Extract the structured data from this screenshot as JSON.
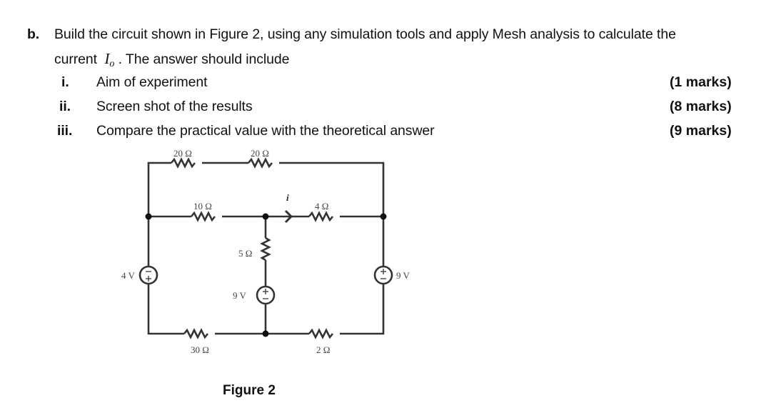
{
  "question": {
    "label": "b.",
    "line1": "Build the circuit shown in Figure 2, using any simulation tools and apply Mesh analysis to calculate the",
    "line2_prefix": "current",
    "variable_main": "I",
    "variable_sub": "o",
    "line2_suffix": ". The answer should include"
  },
  "items": [
    {
      "numeral": "i.",
      "text": "Aim of experiment",
      "marks": "(1 marks)"
    },
    {
      "numeral": "ii.",
      "text": "Screen shot of the results",
      "marks": "(8 marks)"
    },
    {
      "numeral": "iii.",
      "text": "Compare the practical value with the theoretical answer",
      "marks": "(9 marks)"
    }
  ],
  "figure": {
    "caption": "Figure 2",
    "components": {
      "r_top_left": "20 Ω",
      "r_top_right": "20 Ω",
      "r_mid_left": "10 Ω",
      "r_mid_right": "4 Ω",
      "r_center_vertical": "5 Ω",
      "r_bottom_left": "30 Ω",
      "r_bottom_right": "2 Ω",
      "v_left": "4 V",
      "v_center": "9 V",
      "v_right": "9 V",
      "current_label": "i"
    },
    "colors": {
      "wire": "#333333",
      "label": "#444444"
    }
  }
}
